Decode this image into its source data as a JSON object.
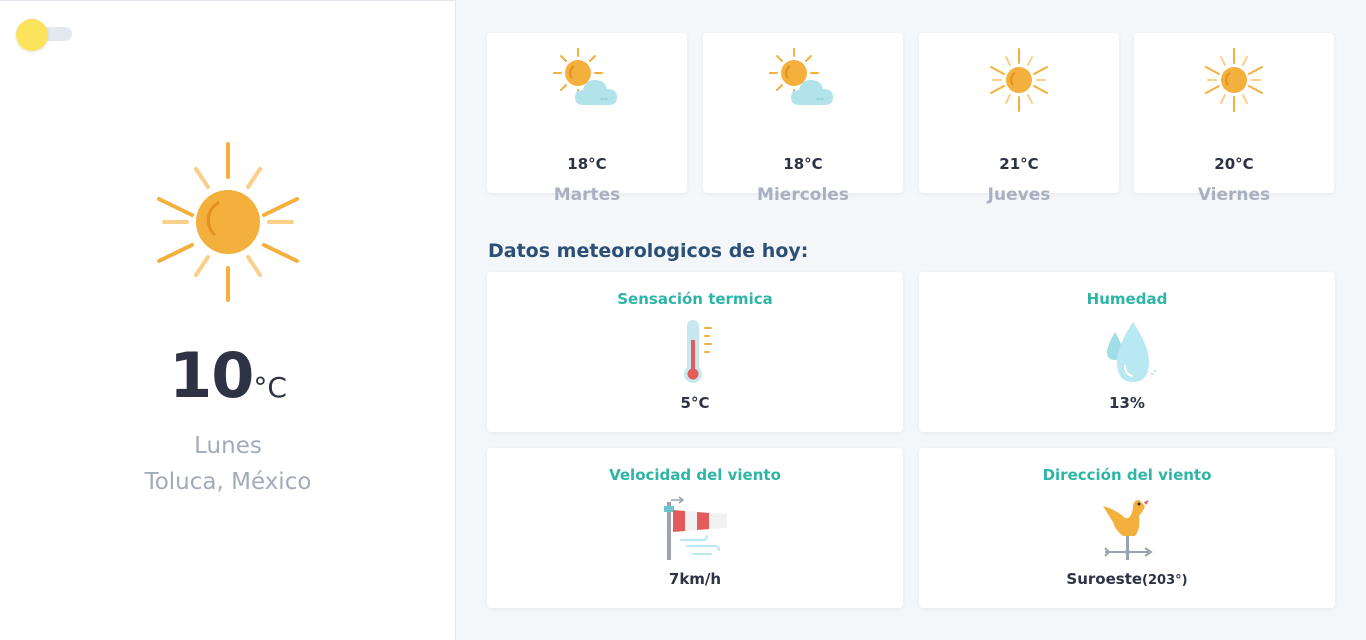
{
  "theme_toggle": {
    "state": "light",
    "knob_color": "#fce35e"
  },
  "current": {
    "icon": "sun-icon",
    "temperature": "10",
    "unit": "°C",
    "day": "Lunes",
    "location": "Toluca, México"
  },
  "forecast": [
    {
      "icon": "partly-cloudy-icon",
      "temp": "18°C",
      "day": "Martes"
    },
    {
      "icon": "partly-cloudy-icon",
      "temp": "18°C",
      "day": "Miercoles"
    },
    {
      "icon": "sun-icon",
      "temp": "21°C",
      "day": "Jueves"
    },
    {
      "icon": "sun-icon",
      "temp": "20°C",
      "day": "Viernes"
    }
  ],
  "today": {
    "title": "Datos meteorologicos de hoy:",
    "stats": [
      {
        "label": "Sensación termica",
        "icon": "thermometer-icon",
        "value": "5°C"
      },
      {
        "label": "Humedad",
        "icon": "water-drops-icon",
        "value": "13%"
      },
      {
        "label": "Velocidad del viento",
        "icon": "windsock-icon",
        "value": "7km/h"
      },
      {
        "label": "Dirección del viento",
        "icon": "weather-vane-icon",
        "value": "Suroeste",
        "value_extra": "(203°)"
      }
    ]
  },
  "colors": {
    "accent": "#2fb5a5",
    "title": "#2c4f76",
    "sun": "#f3b03c",
    "muted": "#a3abbb"
  }
}
